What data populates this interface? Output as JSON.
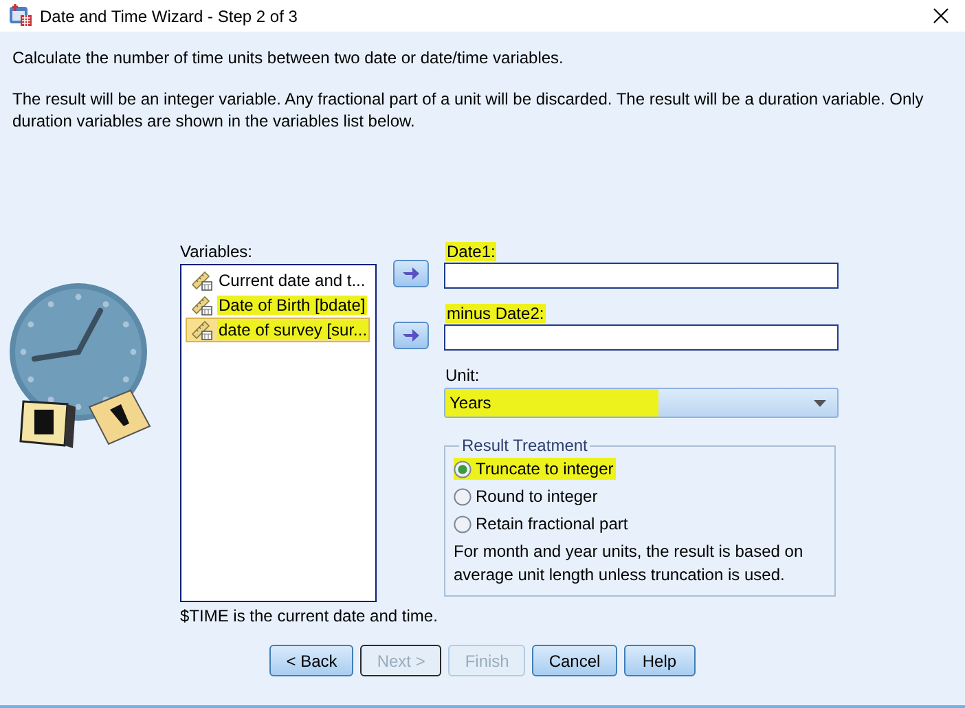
{
  "window": {
    "title": "Date and Time Wizard - Step 2 of 3"
  },
  "description": "Calculate the number of time units between two date or date/time variables.",
  "note": "The result will be an integer variable. Any fractional part of a unit will be discarded. The result will be a duration variable. Only duration variables are shown in the variables list below.",
  "variables": {
    "label": "Variables:",
    "items": [
      {
        "name": "Current date and t...",
        "selected": false,
        "highlighted": false
      },
      {
        "name": "Date of Birth [bdate]",
        "selected": false,
        "highlighted": true
      },
      {
        "name": "date of survey [sur...",
        "selected": true,
        "highlighted": true
      }
    ]
  },
  "targets": [
    {
      "label": "Date1:",
      "highlighted": true
    },
    {
      "label": "minus Date2:",
      "highlighted": true
    }
  ],
  "unit": {
    "label": "Unit:",
    "value": "Years",
    "highlighted": true
  },
  "result_treatment": {
    "title": "Result Treatment",
    "options": [
      {
        "label": "Truncate to integer",
        "selected": true,
        "highlighted": true
      },
      {
        "label": "Round to integer",
        "selected": false,
        "highlighted": false
      },
      {
        "label": "Retain fractional part",
        "selected": false,
        "highlighted": false
      }
    ],
    "note": "For month and year units, the result is based on average unit length unless truncation is used."
  },
  "footer": "$TIME is the current date and time.",
  "buttons": [
    {
      "label": "< Back",
      "disabled": false,
      "focused": false
    },
    {
      "label": "Next >",
      "disabled": true,
      "focused": true
    },
    {
      "label": "Finish",
      "disabled": true,
      "focused": false
    },
    {
      "label": "Cancel",
      "disabled": false,
      "focused": false
    },
    {
      "label": "Help",
      "disabled": false,
      "focused": false
    }
  ]
}
